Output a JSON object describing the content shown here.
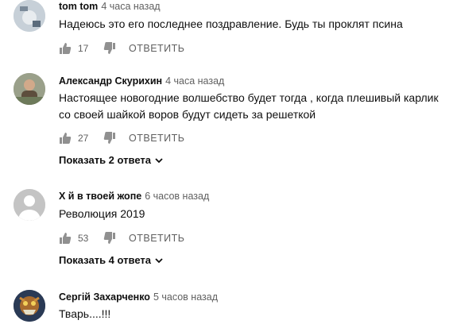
{
  "comments": [
    {
      "author": "tom tom",
      "time": "4 часа назад",
      "text": "Надеюсь это его последнее поздравление. Будь ты проклят псина",
      "likes": "17",
      "reply_label": "ОТВЕТИТЬ"
    },
    {
      "author": "Александр Скурихин",
      "time": "4 часа назад",
      "text": "Настоящее новогодние волшебство будет тогда , когда плешивый карлик со своей шайкой воров будут сидеть за решеткой",
      "likes": "27",
      "reply_label": "ОТВЕТИТЬ",
      "show_replies": "Показать 2 ответа"
    },
    {
      "author": "Х  й в твоей жопе",
      "time": "6 часов назад",
      "text": "Революция 2019",
      "likes": "53",
      "reply_label": "ОТВЕТИТЬ",
      "show_replies": "Показать 4 ответа"
    },
    {
      "author": "Сергій Захарченко",
      "time": "5 часов назад",
      "text": "Тварь....!!!"
    }
  ]
}
